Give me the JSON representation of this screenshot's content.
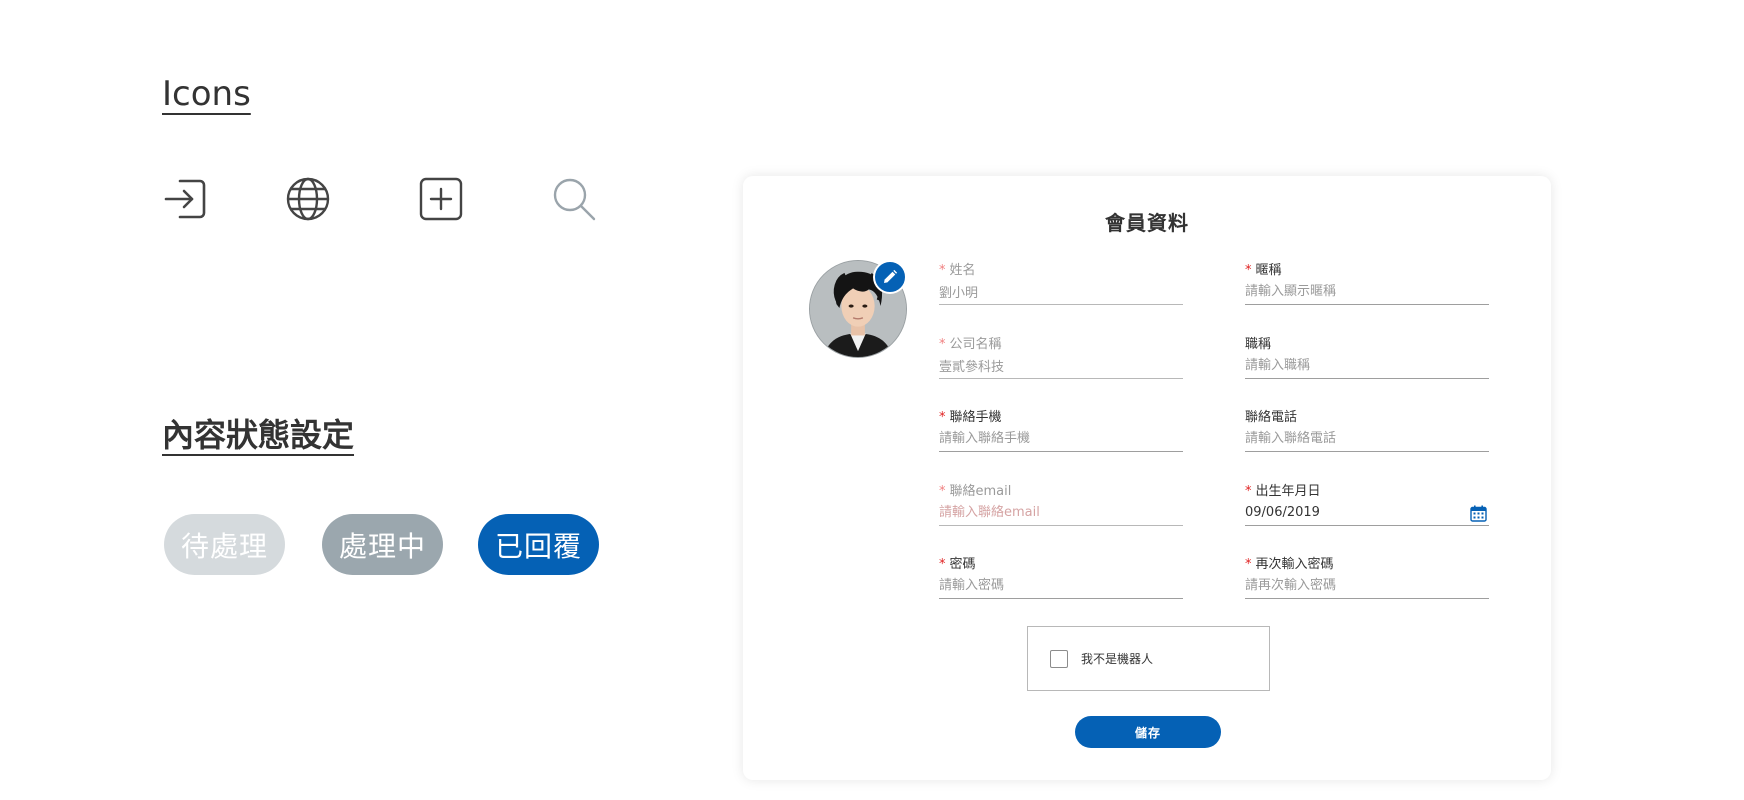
{
  "icons_section": {
    "title": "Icons",
    "icons": [
      "log-in-icon",
      "globe-icon",
      "add-square-icon",
      "search-icon"
    ]
  },
  "status_section": {
    "title": "內容狀態設定",
    "statuses": [
      {
        "label": "待處理",
        "color": "#d5dadd"
      },
      {
        "label": "處理中",
        "color": "#9ba7ae"
      },
      {
        "label": "已回覆",
        "color": "#0561b5"
      }
    ]
  },
  "profile_form": {
    "title": "會員資料",
    "accent_color": "#0561b5",
    "avatar": {
      "edit_icon": "pencil-icon"
    },
    "fields": {
      "name": {
        "label": "姓名",
        "required": true,
        "value": "劉小明"
      },
      "nickname": {
        "label": "暱稱",
        "required": true,
        "placeholder": "請輸入顯示暱稱"
      },
      "company": {
        "label": "公司名稱",
        "required": true,
        "value": "壹貳參科技"
      },
      "job_title": {
        "label": "職稱",
        "required": false,
        "placeholder": "請輸入職稱"
      },
      "mobile": {
        "label": "聯絡手機",
        "required": true,
        "placeholder": "請輸入聯絡手機"
      },
      "phone": {
        "label": "聯絡電話",
        "required": false,
        "placeholder": "請輸入聯絡電話"
      },
      "email": {
        "label": "聯絡email",
        "required": true,
        "placeholder": "請輸入聯絡email"
      },
      "birthday": {
        "label": "出生年月日",
        "required": true,
        "value": "09/06/2019",
        "icon": "calendar-icon"
      },
      "password": {
        "label": "密碼",
        "required": true,
        "placeholder": "請輸入密碼"
      },
      "password_confirm": {
        "label": "再次輸入密碼",
        "required": true,
        "placeholder": "請再次輸入密碼"
      }
    },
    "required_mark": "*",
    "captcha": {
      "label": "我不是機器人",
      "checked": false
    },
    "save_label": "儲存"
  }
}
